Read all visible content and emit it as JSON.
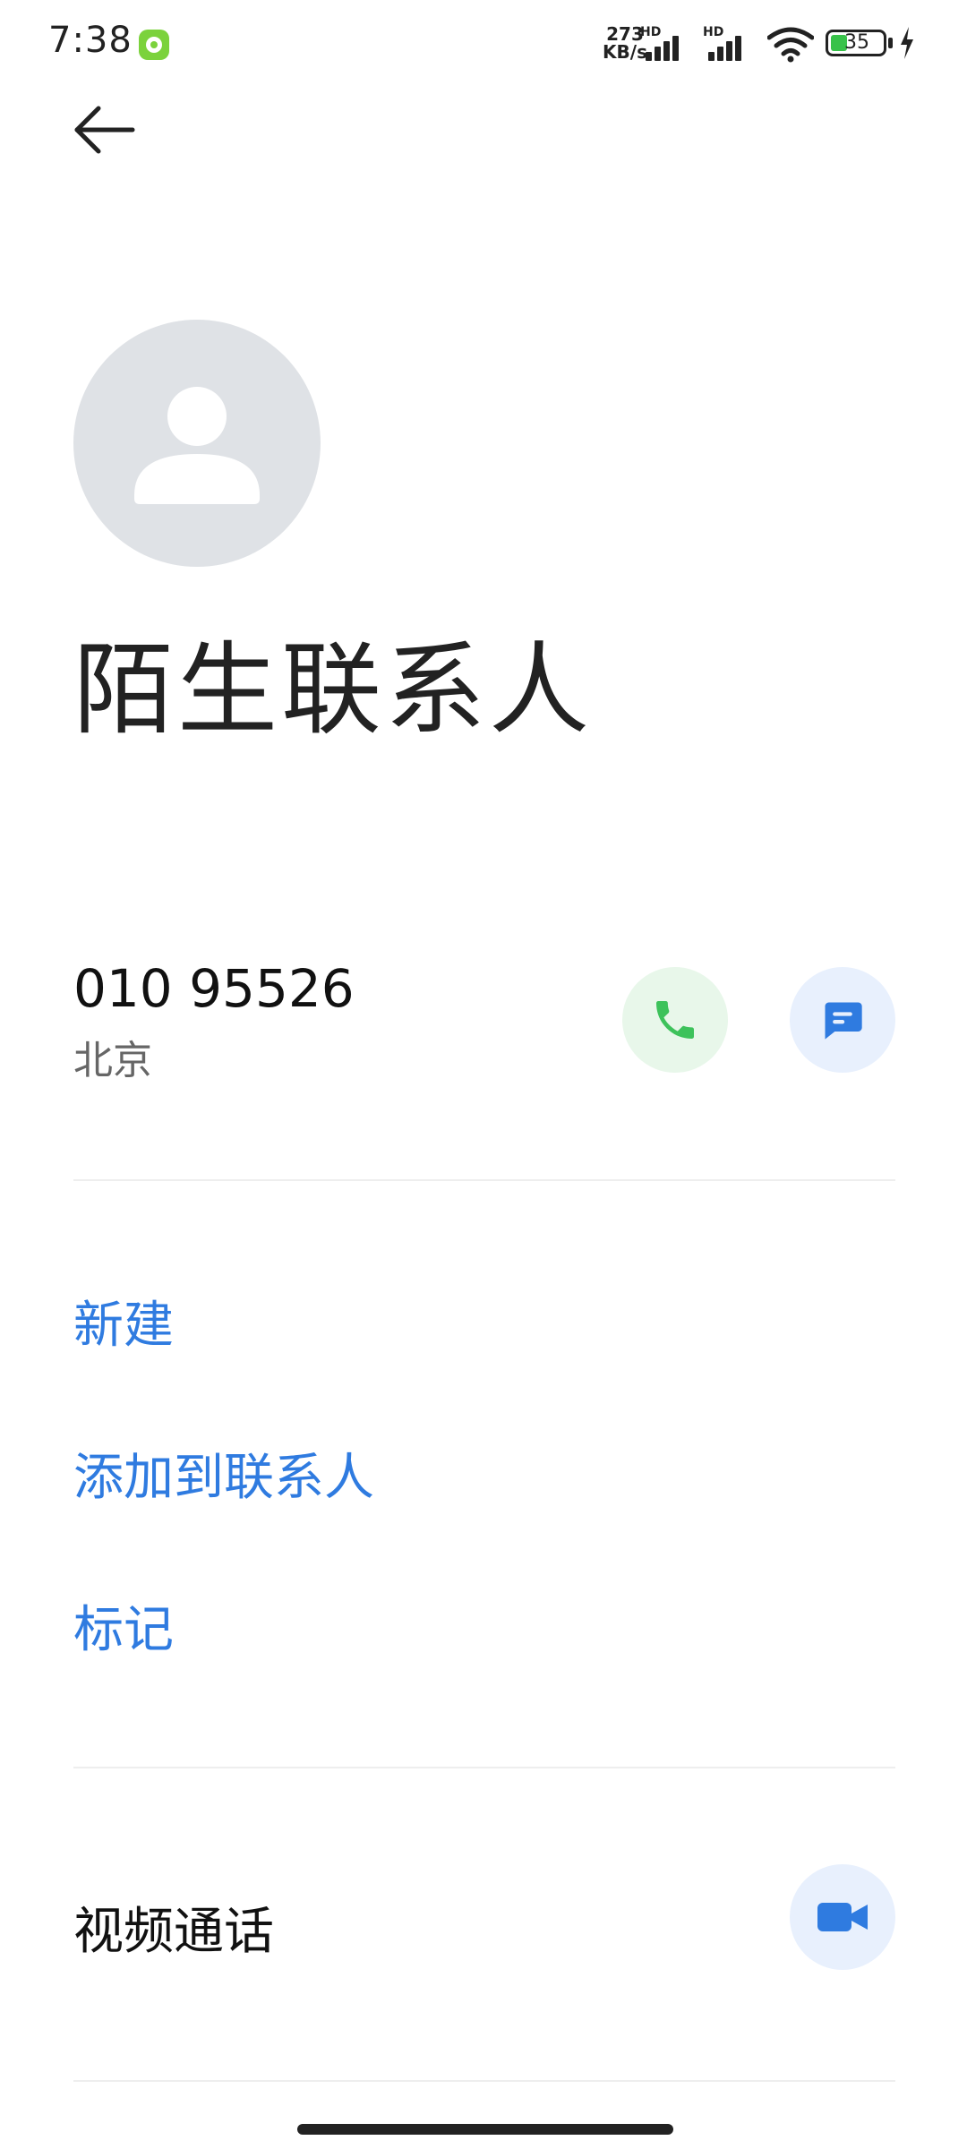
{
  "status_bar": {
    "time": "7:38",
    "net_speed_value": "273",
    "net_speed_unit": "KB/s",
    "signal_1_label": "HD",
    "signal_2_label": "HD",
    "battery_level": "35"
  },
  "contact": {
    "name": "陌生联系人",
    "number": "010 95526",
    "location": "北京"
  },
  "actions": {
    "new_label": "新建",
    "add_to_contacts_label": "添加到联系人",
    "mark_label": "标记"
  },
  "video_call": {
    "label": "视频通话"
  },
  "colors": {
    "accent_blue": "#2f7be0",
    "call_green": "#3dc25b",
    "avatar_gray": "#dfe2e6"
  },
  "icons": {
    "back": "arrow-left-icon",
    "avatar": "person-icon",
    "call": "phone-icon",
    "message": "chat-bubble-icon",
    "video": "video-camera-icon"
  }
}
